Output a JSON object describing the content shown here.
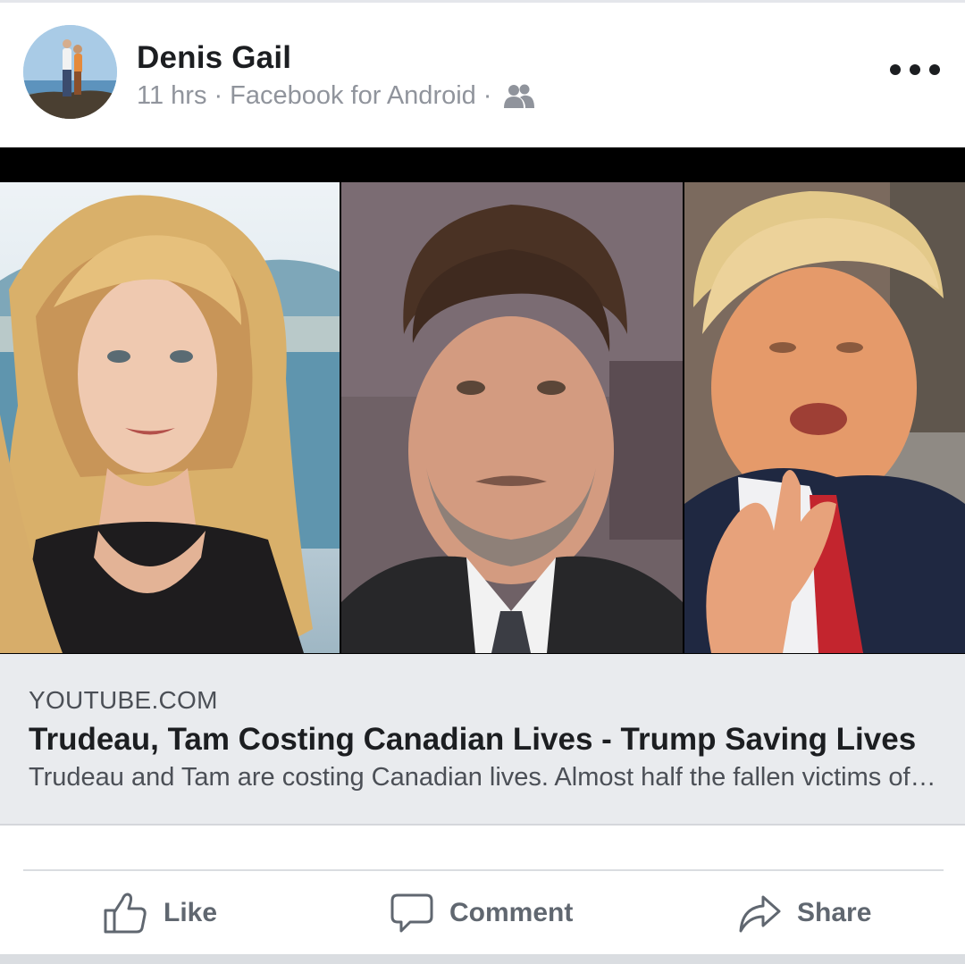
{
  "post": {
    "author": "Denis Gail",
    "time": "11 hrs",
    "separator": "·",
    "source": "Facebook for Android",
    "audience_icon": "friends-icon",
    "more_icon": "more-options-icon"
  },
  "link": {
    "domain": "YOUTUBE.COM",
    "title": "Trudeau, Tam Costing Canadian Lives - Trump Saving Lives",
    "description": "Trudeau and Tam are costing Canadian lives. Almost half the fallen victims of the coronavirus"
  },
  "actions": {
    "like": "Like",
    "comment": "Comment",
    "share": "Share"
  },
  "colors": {
    "text_primary": "#1c1e21",
    "text_secondary": "#90949c",
    "card_background": "#e9ebee",
    "action_text": "#606770"
  }
}
